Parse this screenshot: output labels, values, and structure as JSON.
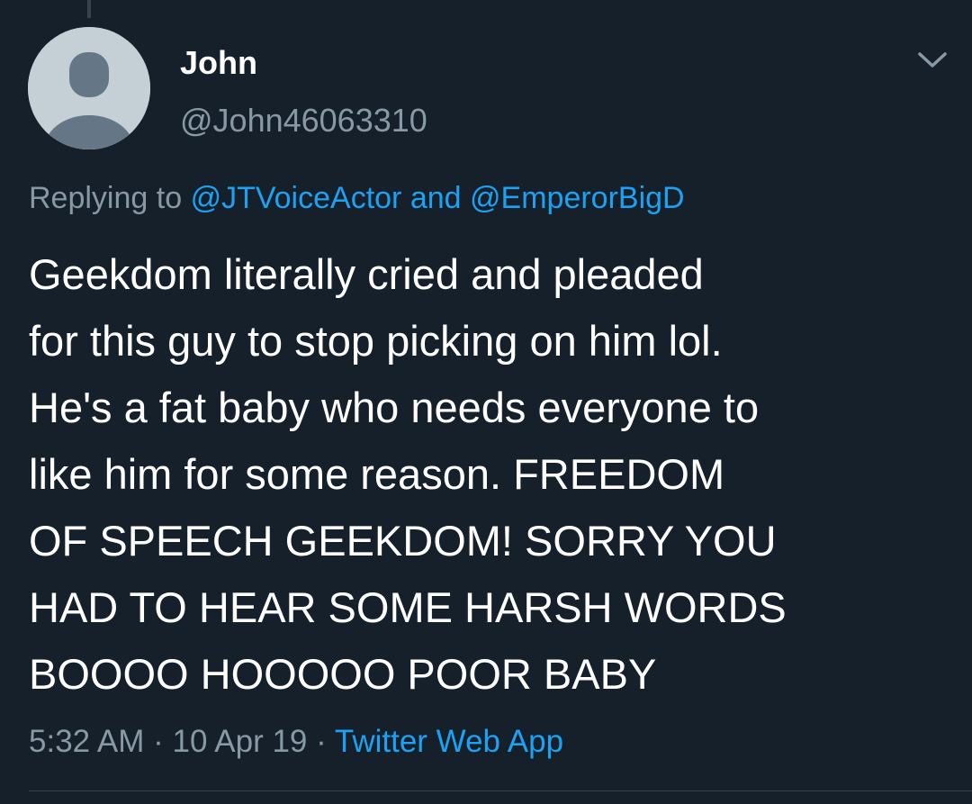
{
  "tweet": {
    "author_name": "John",
    "author_handle": "@John46063310",
    "replying_prefix": "Replying to",
    "replying_to": [
      "@JTVoiceActor",
      "@EmperorBigD"
    ],
    "replying_conjunction": "and",
    "text": "Geekdom literally cried and pleaded\nfor this guy to stop picking on him lol.\nHe's a fat baby who needs everyone to\nlike him for some reason. FREEDOM\nOF SPEECH GEEKDOM! SORRY YOU\nHAD TO HEAR SOME HARSH WORDS\nBOOOO HOOOOO POOR BABY",
    "time": "5:32 AM",
    "date": "10 Apr 19",
    "separator": "·",
    "source": "Twitter Web App"
  },
  "icons": {
    "avatar": "default-avatar-icon",
    "menu": "chevron-down-icon"
  },
  "colors": {
    "background": "#15202b",
    "primary_text": "#ffffff",
    "secondary_text": "#8899a6",
    "link": "#1da1f2",
    "avatar_bg": "#c4cfd6",
    "avatar_fg": "#657786"
  }
}
